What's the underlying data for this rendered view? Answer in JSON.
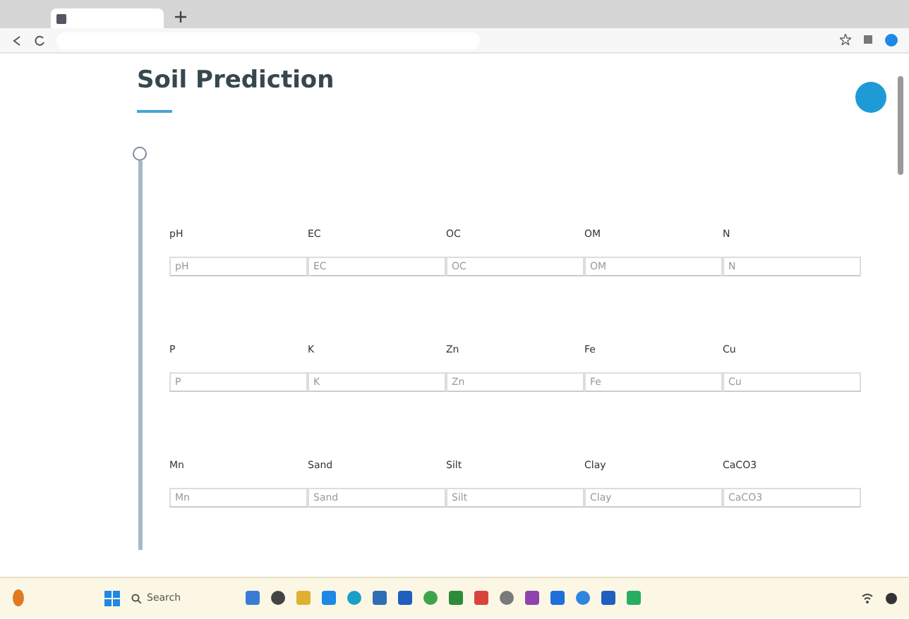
{
  "page": {
    "title": "Soil Prediction",
    "field_rows": [
      [
        {
          "label": "pH",
          "placeholder": "pH"
        },
        {
          "label": "EC",
          "placeholder": "EC"
        },
        {
          "label": "OC",
          "placeholder": "OC"
        },
        {
          "label": "OM",
          "placeholder": "OM"
        },
        {
          "label": "N",
          "placeholder": "N"
        }
      ],
      [
        {
          "label": "P",
          "placeholder": "P"
        },
        {
          "label": "K",
          "placeholder": "K"
        },
        {
          "label": "Zn",
          "placeholder": "Zn"
        },
        {
          "label": "Fe",
          "placeholder": "Fe"
        },
        {
          "label": "Cu",
          "placeholder": "Cu"
        }
      ],
      [
        {
          "label": "Mn",
          "placeholder": "Mn"
        },
        {
          "label": "Sand",
          "placeholder": "Sand"
        },
        {
          "label": "Silt",
          "placeholder": "Silt"
        },
        {
          "label": "Clay",
          "placeholder": "Clay"
        },
        {
          "label": "CaCO3",
          "placeholder": "CaCO3"
        }
      ]
    ]
  },
  "taskbar": {
    "search": {
      "placeholder": "Search"
    }
  }
}
